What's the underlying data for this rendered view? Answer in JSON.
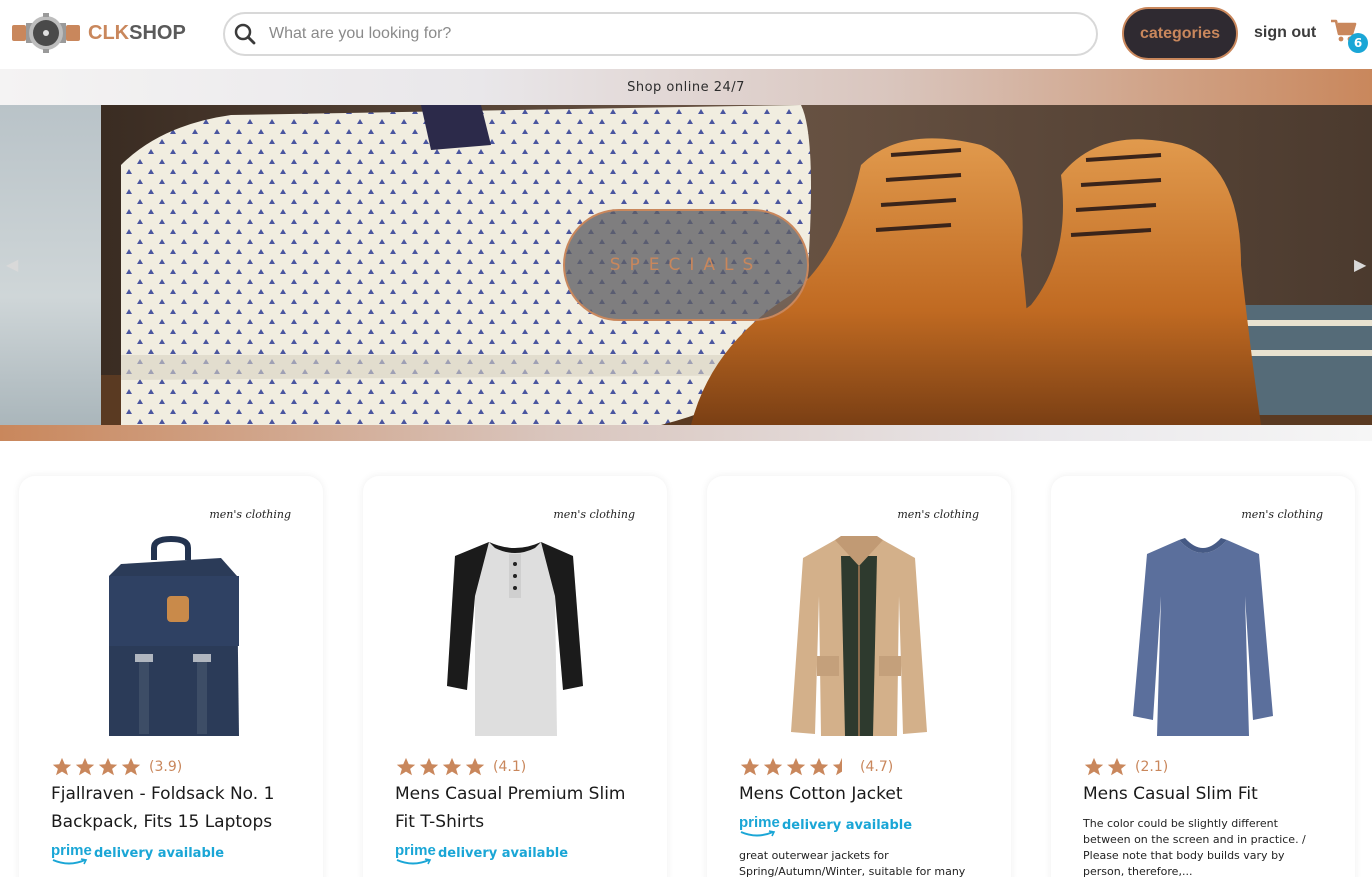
{
  "header": {
    "logo_clk": "CLK",
    "logo_shop": "SHOP",
    "search_placeholder": "What are you looking for?",
    "categories_label": "categories",
    "signout_label": "sign out",
    "cart_count": "6"
  },
  "strip": {
    "text": "Shop online 24/7"
  },
  "banner": {
    "label": "SPECIALS"
  },
  "colors": {
    "accent": "#c9875c",
    "dark": "#2f2a31",
    "prime": "#1aa6d6"
  },
  "products": [
    {
      "category": "men's clothing",
      "rating": "(3.9)",
      "stars": 4,
      "title": "Fjallraven - Foldsack No. 1 Backpack, Fits 15 Laptops",
      "prime_logo": "prime",
      "prime_text": "delivery available",
      "description": ""
    },
    {
      "category": "men's clothing",
      "rating": "(4.1)",
      "stars": 4,
      "title": "Mens Casual Premium Slim Fit T-Shirts",
      "prime_logo": "prime",
      "prime_text": "delivery available",
      "description": ""
    },
    {
      "category": "men's clothing",
      "rating": "(4.7)",
      "stars": 4.5,
      "title": "Mens Cotton Jacket",
      "prime_logo": "prime",
      "prime_text": "delivery available",
      "description": "great outerwear jackets for Spring/Autumn/Winter, suitable for many"
    },
    {
      "category": "men's clothing",
      "rating": "(2.1)",
      "stars": 2,
      "title": "Mens Casual Slim Fit",
      "prime_logo": "",
      "prime_text": "",
      "description": "The color could be slightly different between on the screen and in practice. / Please note that body builds vary by person, therefore,..."
    }
  ]
}
